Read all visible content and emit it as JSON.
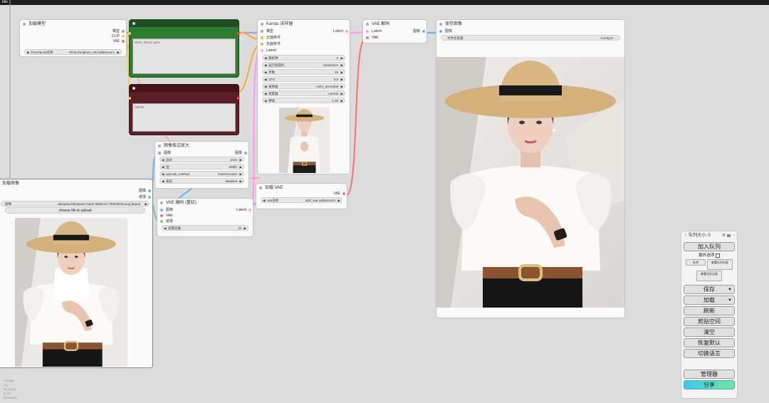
{
  "window": {
    "title": "Idle"
  },
  "colors": {
    "model": "#b39ddb",
    "clip": "#f2d14b",
    "vae": "#ff6e6e",
    "latent": "#ff9cf9",
    "image": "#64b5f6",
    "conditioning": "#ffa931",
    "cond_pos": "#2e7d32",
    "cond_neg": "#5d1f26"
  },
  "load_checkpoint": {
    "title": "加载模型",
    "outputs": [
      "模型",
      "CLIP",
      "VAE"
    ],
    "ckpt_label": "Checkpoint名称",
    "ckpt_value": "SDXLRonghua_v40.safetensors"
  },
  "prompt_pos": {
    "placeholder": "MAN, flared, pack"
  },
  "prompt_neg": {
    "placeholder": "NSFW"
  },
  "ksampler": {
    "title": "Karras 采样器",
    "inputs": [
      "模型",
      "正面条件",
      "负面条件",
      "Latent"
    ],
    "output": "Latent",
    "widgets": [
      {
        "label": "随机种",
        "value": "0"
      },
      {
        "label": "运行后操作",
        "value": "randomize"
      },
      {
        "label": "步数",
        "value": "20"
      },
      {
        "label": "CFG",
        "value": "8.0"
      },
      {
        "label": "采样器",
        "value": "euler_ancestral"
      },
      {
        "label": "调度器",
        "value": "normal"
      },
      {
        "label": "降噪",
        "value": "1.00"
      }
    ]
  },
  "vae_decode": {
    "title": "VAE 解码",
    "inputs": [
      "Latent",
      "VAE"
    ],
    "output": "图像"
  },
  "save_image": {
    "title": "保存图像",
    "input": "图像",
    "prefix_label": "文件名前缀",
    "prefix_value": "ComfyUI"
  },
  "upscale": {
    "title": "图像按边放大",
    "input": "图像",
    "output": "图像",
    "widgets": [
      {
        "label": "边长",
        "value": "1024"
      },
      {
        "label": "边",
        "value": "Width"
      },
      {
        "label": "upscale_method",
        "value": "nearest-exact"
      },
      {
        "label": "裁剪",
        "value": "disabled"
      }
    ]
  },
  "load_image": {
    "title": "加载图像",
    "outputs": [
      "图像",
      "遮罩"
    ],
    "image_label": "图像",
    "image_value": "clipspace/clipspace-mask-3858123.700000003.png [input]",
    "upload_label": "choose file to upload"
  },
  "vae_encode": {
    "title": "VAE 编码 (重绘)",
    "inputs": [
      "图像",
      "VAE",
      "遮罩"
    ],
    "output": "Latent",
    "widget": {
      "label": "遮罩延展",
      "value": "15"
    }
  },
  "load_vae": {
    "title": "加载 VAE",
    "output": "VAE",
    "widget": {
      "label": "vae名称",
      "value": "sdxl_vae.safetensors"
    }
  },
  "queue": {
    "title": "队列大小: 0",
    "queue_button": "加入队列",
    "extra_options": "额外选项",
    "btn_queue": "队列",
    "btn_view_queue": "查看队列内容",
    "btn_view_history": "查看历史记录",
    "save": "保存",
    "load": "加载",
    "refresh": "刷新",
    "clipspace": "剪贴空间",
    "clear": "清空",
    "restore": "恢复默认",
    "language": "切换语言",
    "manager": "管理器",
    "share": "分享"
  },
  "stats": [
    "T: 0.00s",
    "I: 0",
    "N: 11 [11]",
    "V: 23",
    "FPS:49.21"
  ]
}
